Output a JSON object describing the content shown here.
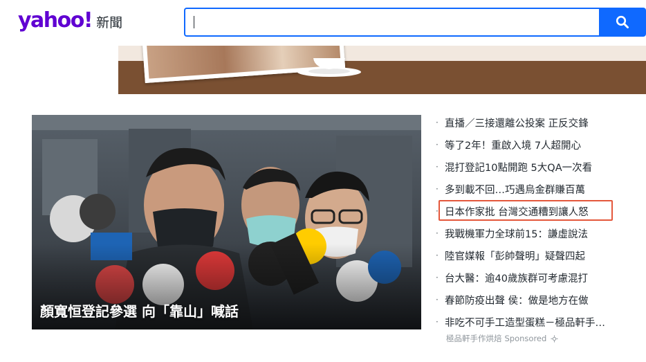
{
  "brand": {
    "logo": "yahoo!",
    "section": "新聞"
  },
  "search": {
    "value": "",
    "placeholder": ""
  },
  "hero": {
    "caption": "顏寬恒登記參選 向「靠山」喊話"
  },
  "headlines": [
    "直播／三接還離公投案 正反交鋒",
    "等了2年！重啟入境 7人超開心",
    "混打登記10點開跑 5大QA一次看",
    "多到載不回…巧遇烏金群賺百萬",
    "日本作家批 台灣交通糟到讓人怒",
    "我戰機軍力全球前15：謙虛說法",
    "陸官媒報「彭帥聲明」疑聲四起",
    "台大醫：逾40歲族群可考慮混打",
    "春節防疫出聲 侯：做是地方在做",
    "非吃不可手工造型蛋糕－極品軒手…"
  ],
  "sponsor": {
    "advertiser": "極品軒手作烘焙",
    "label": "Sponsored"
  },
  "colors": {
    "brand_purple": "#6001d2",
    "search_blue": "#0f69ff",
    "highlight_red": "#e4573b"
  },
  "icons": {
    "search": "search-icon",
    "sponsor": "ad-choices-icon"
  }
}
